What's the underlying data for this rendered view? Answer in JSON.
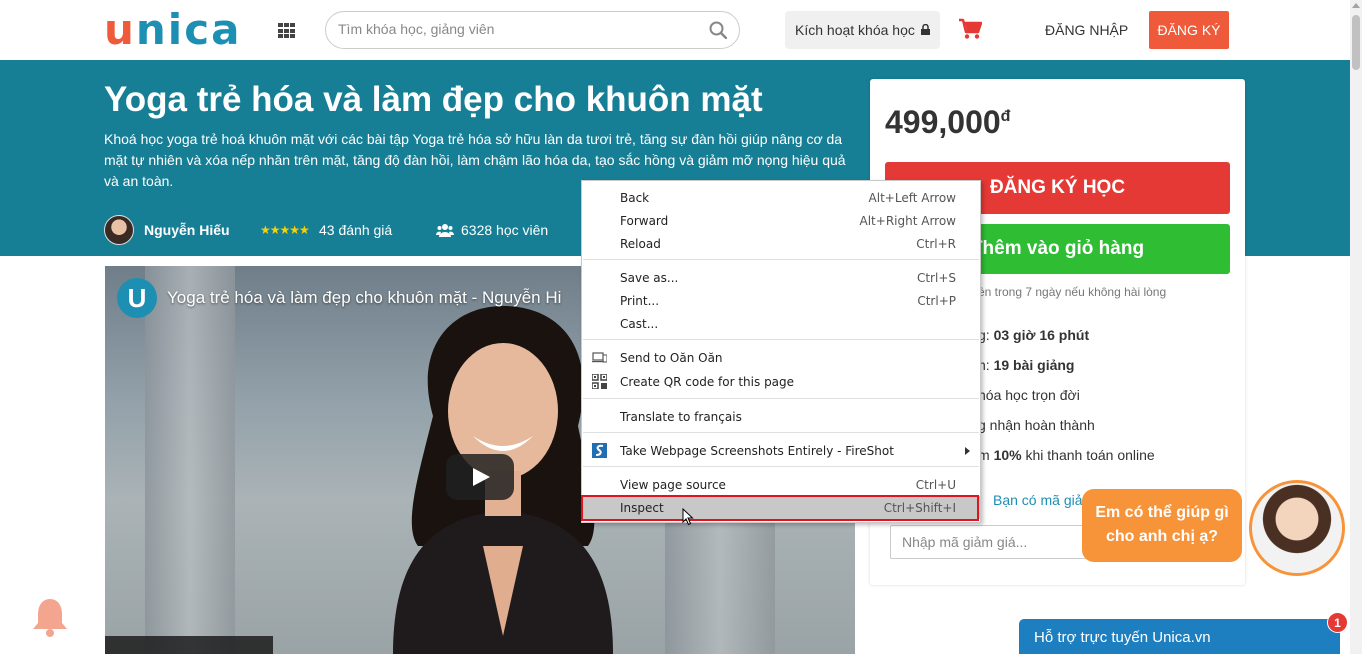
{
  "header": {
    "logo_u": "u",
    "logo_rest": "nica",
    "search_placeholder": "Tìm khóa học, giảng viên",
    "activate_label": "Kích hoạt khóa học",
    "login_label": "ĐĂNG NHẬP",
    "register_label": "ĐĂNG KÝ"
  },
  "course": {
    "title": "Yoga trẻ hóa và làm đẹp cho khuôn mặt",
    "description": "Khoá học yoga trẻ hoá khuôn mặt với các bài tập Yoga trẻ hóa sở hữu làn da tươi trẻ, tăng sự đàn hồi giúp nâng cơ da mặt tự nhiên và xóa nếp nhăn trên mặt, tăng độ đàn hồi, làm chậm lão hóa da, tạo sắc hồng và giảm mỡ nọng hiệu quả và an toàn.",
    "author": "Nguyễn Hiếu",
    "stars": "★★★★★",
    "rating_count": "43 đánh giá",
    "students": "6328 học viên"
  },
  "video": {
    "logo_letter": "U",
    "title": "Yoga trẻ hóa và làm đẹp cho khuôn mặt - Nguyễn Hi"
  },
  "card": {
    "price": "499,000",
    "currency": "đ",
    "enroll_label": "ĐĂNG KÝ HỌC",
    "cart_label": "Thêm vào giỏ hàng",
    "refund_note": "ền trong 7 ngày nếu không hài lòng",
    "duration_prefix": "g: ",
    "duration_value": "03 giờ 16 phút",
    "lessons_prefix": "n: ",
    "lessons_value": "19 bài giảng",
    "lifetime": "hóa học trọn đời",
    "certificate": "g nhận hoàn thành",
    "discount_prefix": "m ",
    "discount_value": "10%",
    "discount_suffix": " khi thanh toán online",
    "coupon_link": "Bạn có mã giả",
    "coupon_placeholder": "Nhập mã giảm giá..."
  },
  "chat": {
    "bubble_line1": "Em có thể giúp gì",
    "bubble_line2": "cho anh chị ạ?"
  },
  "support": {
    "label": "Hỗ trợ trực tuyến Unica.vn",
    "badge_count": "1"
  },
  "context_menu": {
    "items": [
      {
        "label": "Back",
        "shortcut": "Alt+Left Arrow"
      },
      {
        "label": "Forward",
        "shortcut": "Alt+Right Arrow"
      },
      {
        "label": "Reload",
        "shortcut": "Ctrl+R"
      },
      {
        "label": "Save as...",
        "shortcut": "Ctrl+S"
      },
      {
        "label": "Print...",
        "shortcut": "Ctrl+P"
      },
      {
        "label": "Cast...",
        "shortcut": ""
      },
      {
        "label": "Send to Oăn Oăn",
        "shortcut": "",
        "icon": "device-icon"
      },
      {
        "label": "Create QR code for this page",
        "shortcut": "",
        "icon": "qr-code-icon"
      },
      {
        "label": "Translate to français",
        "shortcut": ""
      },
      {
        "label": "Take Webpage Screenshots Entirely - FireShot",
        "shortcut": "",
        "icon": "fireshot-icon"
      },
      {
        "label": "View page source",
        "shortcut": "Ctrl+U"
      },
      {
        "label": "Inspect",
        "shortcut": "Ctrl+Shift+I"
      }
    ],
    "highlight_color": "#e0141e"
  },
  "colors": {
    "brand_orange": "#ef5a3a",
    "brand_blue": "#1d8fb3",
    "hero_bg": "#167f96",
    "enroll_red": "#e53935",
    "cart_green": "#2ebd33"
  }
}
